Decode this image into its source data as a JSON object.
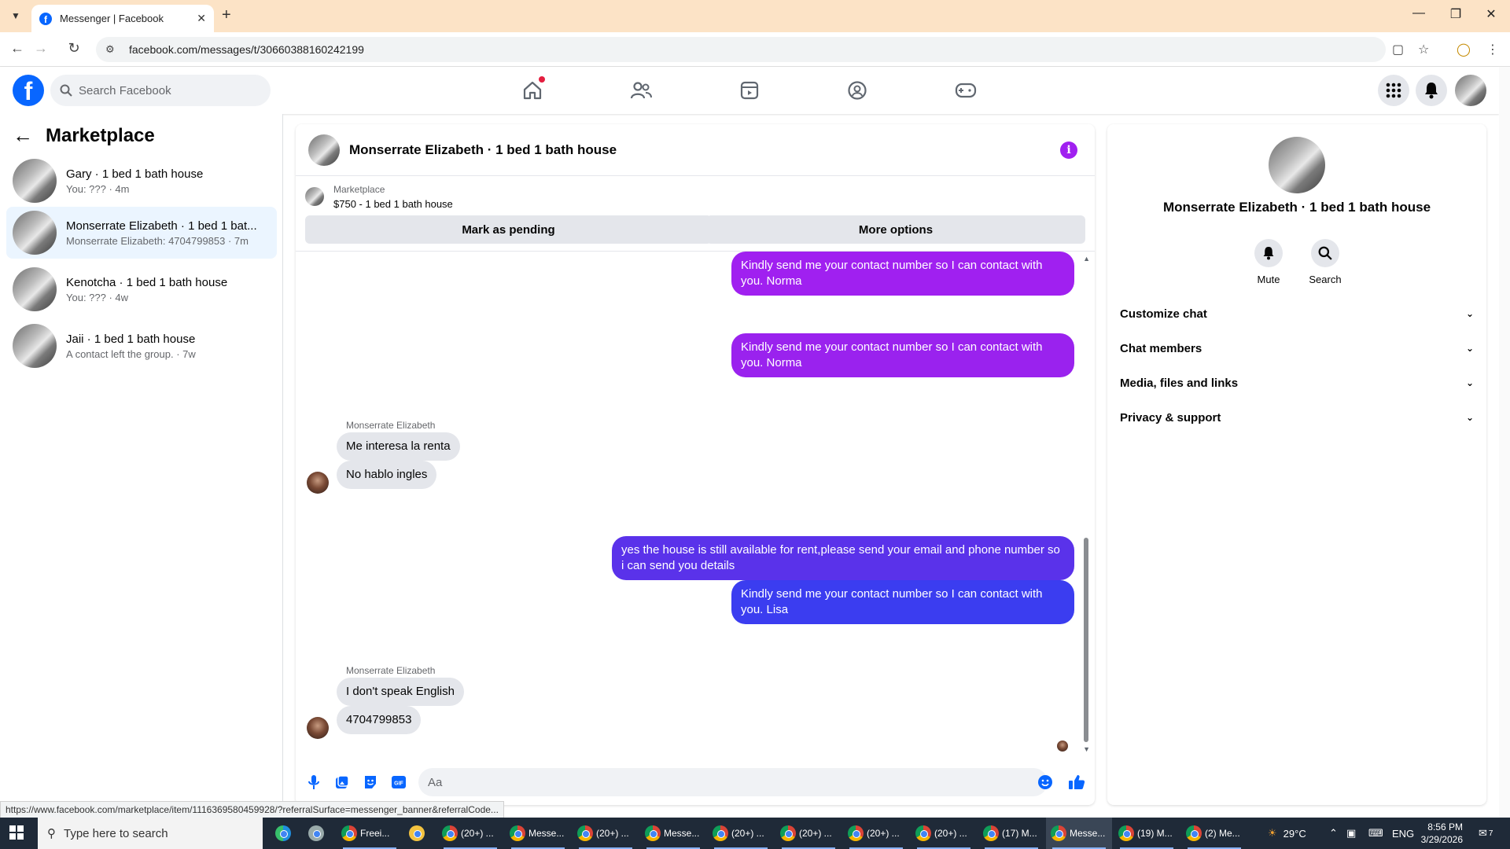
{
  "browser": {
    "tab_title": "Messenger | Facebook",
    "url": "facebook.com/messages/t/30660388160242199",
    "status_link": "https://www.facebook.com/marketplace/item/1116369580459928/?referralSurface=messenger_banner&referralCode..."
  },
  "header": {
    "search_placeholder": "Search Facebook"
  },
  "sidebar": {
    "title": "Marketplace",
    "conversations": [
      {
        "name": "Gary · 1 bed 1 bath house",
        "preview": "You: ??? · 4m"
      },
      {
        "name": "Monserrate Elizabeth · 1 bed 1 bat...",
        "preview": "Monserrate Elizabeth: 4704799853 · 7m"
      },
      {
        "name": "Kenotcha · 1 bed 1 bath house",
        "preview": "You: ??? · 4w"
      },
      {
        "name": "Jaii · 1 bed 1 bath house",
        "preview": "A contact left the group. · 7w"
      }
    ]
  },
  "chat": {
    "title": "Monserrate Elizabeth · 1 bed 1 bath house",
    "banner_label": "Marketplace",
    "banner_listing": "$750 - 1 bed 1 bath house",
    "mark_pending": "Mark as pending",
    "more_options": "More options",
    "messages": {
      "out1": "Kindly send me your contact number so I can contact with you. Norma",
      "out2": "Kindly send me your contact number so I can contact with you. Norma",
      "sender1": "Monserrate Elizabeth",
      "in1": "Me interesa la renta",
      "in2": "No hablo ingles",
      "out3": "yes the house is still available for rent,please send your email and phone number so i can send you details",
      "out4": "Kindly send me your contact number so I can contact with you. Lisa",
      "sender2": "Monserrate Elizabeth",
      "in3": "I don't speak English",
      "in4": "4704799853"
    },
    "composer_placeholder": "Aa"
  },
  "info_panel": {
    "name": "Monserrate Elizabeth · 1 bed 1 bath house",
    "mute_label": "Mute",
    "search_label": "Search",
    "sections": [
      "Customize chat",
      "Chat members",
      "Media, files and links",
      "Privacy & support"
    ]
  },
  "taskbar": {
    "search_placeholder": "Type here to search",
    "items": [
      "Freei...",
      "(20+) ...",
      "Messe...",
      "(20+) ...",
      "Messe...",
      "(20+) ...",
      "(20+) ...",
      "(20+) ...",
      "(20+) ...",
      "(17) M...",
      "Messe...",
      "(19) M...",
      "(2) Me..."
    ],
    "temperature": "29°C",
    "language": "ENG",
    "time": "8:56 PM",
    "date": "3/29/2026",
    "notification_count": "7"
  },
  "colors": {
    "fb_blue": "#0866ff",
    "bubble_purple": "#a020f0",
    "bubble_violet": "#8a2be2",
    "bubble_blue": "#3b3df0",
    "tabbar_bg": "#fce3c6"
  }
}
